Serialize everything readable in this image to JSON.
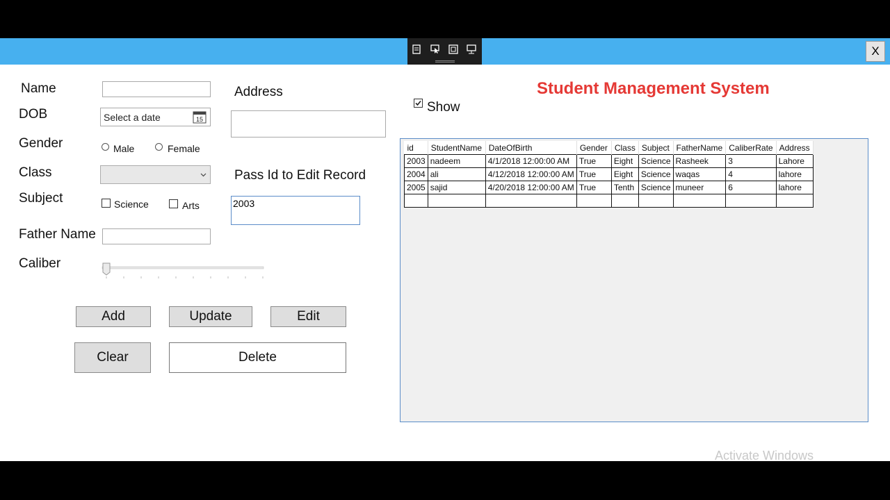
{
  "window": {
    "close_label": "X"
  },
  "form": {
    "name_label": "Name",
    "name_value": "",
    "dob_label": "DOB",
    "dob_placeholder": "Select a date",
    "calendar_day": "15",
    "gender_label": "Gender",
    "gender_options": [
      "Male",
      "Female"
    ],
    "class_label": "Class",
    "class_value": "",
    "subject_label": "Subject",
    "subject_options": [
      "Science",
      "Arts"
    ],
    "father_label": "Father Name",
    "father_value": "",
    "caliber_label": "Caliber",
    "caliber_level": 0,
    "address_label": "Address",
    "address_value": "",
    "pass_label": "Pass Id to Edit Record",
    "pass_value": "2003"
  },
  "buttons": {
    "add": "Add",
    "update": "Update",
    "edit": "Edit",
    "clear": "Clear",
    "delete": "Delete"
  },
  "header": {
    "title": "Student Management System",
    "title_color": "#e53935",
    "show_label": "Show",
    "show_checked": true
  },
  "grid": {
    "columns": [
      "id",
      "StudentName",
      "DateOfBirth",
      "Gender",
      "Class",
      "Subject",
      "FatherName",
      "CaliberRate",
      "Address"
    ],
    "rows": [
      [
        "2003",
        "nadeem",
        "4/1/2018 12:00:00 AM",
        "True",
        "Eight",
        "Science",
        "Rasheek",
        "3",
        "Lahore"
      ],
      [
        "2004",
        "ali",
        "4/12/2018 12:00:00 AM",
        "True",
        "Eight",
        "Science",
        "waqas",
        "4",
        "lahore"
      ],
      [
        "2005",
        "sajid",
        "4/20/2018 12:00:00 AM",
        "True",
        "Tenth",
        "Science",
        "muneer",
        "6",
        "lahore"
      ],
      [
        "",
        "",
        "",
        "",
        "",
        "",
        "",
        "",
        ""
      ]
    ]
  },
  "watermark": "Activate Windows",
  "colors": {
    "titlebar": "#47b0ef",
    "grid_border": "#5a8cc8"
  }
}
